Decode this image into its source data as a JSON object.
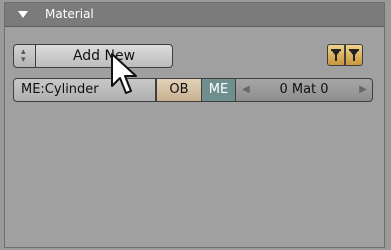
{
  "panel": {
    "title": "Material"
  },
  "material": {
    "add_new_label": "Add New",
    "mesh_name": "ME:Cylinder",
    "ob_label": "OB",
    "me_label": "ME",
    "mat_count": "0 Mat 0"
  },
  "colors": {
    "header_bg": "#7b7b7b",
    "panel_bg": "#a0a0a0",
    "me_active": "#6f8f8f",
    "ob_button": "#d6c2a4",
    "pin_button": "#e0b55a"
  },
  "icons": {
    "collapse": "triangle-down-icon",
    "menu": "up-down-arrows-icon",
    "pin": "pin-icon",
    "cursor": "mouse-pointer-icon"
  }
}
